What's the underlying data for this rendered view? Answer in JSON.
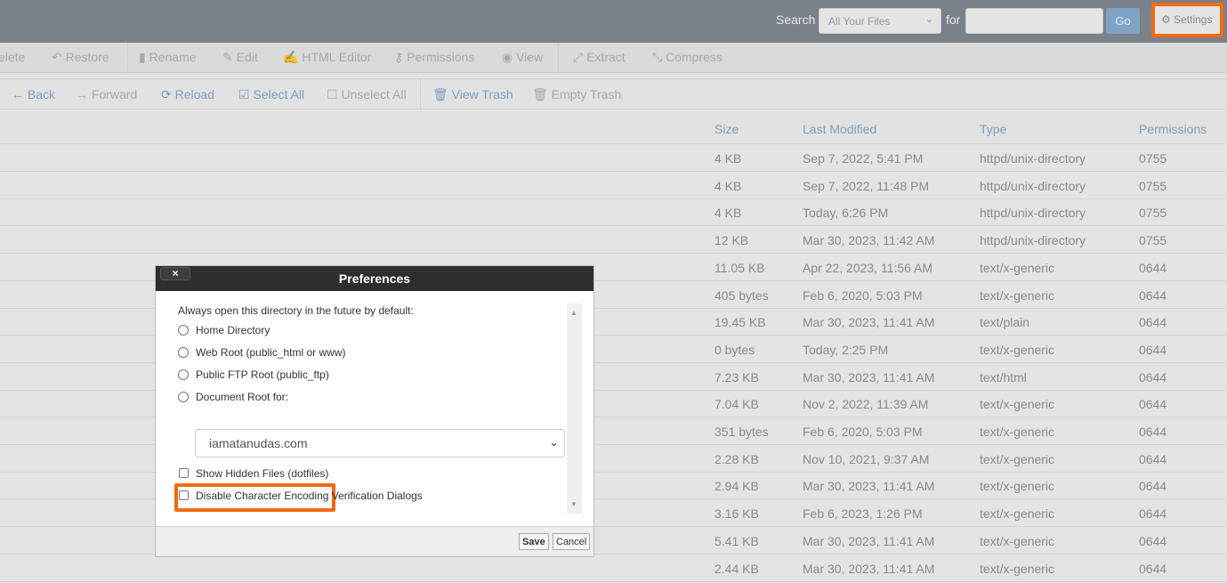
{
  "search": {
    "label": "Search",
    "scope": "All Your Files",
    "for_label": "for",
    "query": "",
    "go": "Go",
    "settings": "Settings"
  },
  "toolbar1": [
    "elete",
    "Restore",
    "Rename",
    "Edit",
    "HTML Editor",
    "Permissions",
    "View",
    "Extract",
    "Compress"
  ],
  "toolbar2": [
    "Back",
    "Forward",
    "Reload",
    "Select All",
    "Unselect All",
    "View Trash",
    "Empty Trash"
  ],
  "columns": [
    "Size",
    "Last Modified",
    "Type",
    "Permissions"
  ],
  "rows": [
    [
      "4 KB",
      "Sep 7, 2022, 5:41 PM",
      "httpd/unix-directory",
      "0755"
    ],
    [
      "4 KB",
      "Sep 7, 2022, 11:48 PM",
      "httpd/unix-directory",
      "0755"
    ],
    [
      "4 KB",
      "Today, 6:26 PM",
      "httpd/unix-directory",
      "0755"
    ],
    [
      "12 KB",
      "Mar 30, 2023, 11:42 AM",
      "httpd/unix-directory",
      "0755"
    ],
    [
      "11.05 KB",
      "Apr 22, 2023, 11:56 AM",
      "text/x-generic",
      "0644"
    ],
    [
      "405 bytes",
      "Feb 6, 2020, 5:03 PM",
      "text/x-generic",
      "0644"
    ],
    [
      "19.45 KB",
      "Mar 30, 2023, 11:41 AM",
      "text/plain",
      "0644"
    ],
    [
      "0 bytes",
      "Today, 2:25 PM",
      "text/x-generic",
      "0644"
    ],
    [
      "7.23 KB",
      "Mar 30, 2023, 11:41 AM",
      "text/html",
      "0644"
    ],
    [
      "7.04 KB",
      "Nov 2, 2022, 11:39 AM",
      "text/x-generic",
      "0644"
    ],
    [
      "351 bytes",
      "Feb 6, 2020, 5:03 PM",
      "text/x-generic",
      "0644"
    ],
    [
      "2.28 KB",
      "Nov 10, 2021, 9:37 AM",
      "text/x-generic",
      "0644"
    ],
    [
      "2.94 KB",
      "Mar 30, 2023, 11:41 AM",
      "text/x-generic",
      "0644"
    ],
    [
      "3.16 KB",
      "Feb 6, 2023, 1:26 PM",
      "text/x-generic",
      "0644"
    ],
    [
      "5.41 KB",
      "Mar 30, 2023, 11:41 AM",
      "text/x-generic",
      "0644"
    ],
    [
      "2.44 KB",
      "Mar 30, 2023, 11:41 AM",
      "text/x-generic",
      "0644"
    ]
  ],
  "dialog": {
    "title": "Preferences",
    "close": "×",
    "intro": "Always open this directory in the future by default:",
    "options": [
      "Home Directory",
      "Web Root (public_html or www)",
      "Public FTP Root (public_ftp)",
      "Document Root for:"
    ],
    "domain": "iamatanudas.com",
    "show_hidden": "Show Hidden Files (dotfiles)",
    "disable_encoding": "Disable Character Encoding Verification Dialogs",
    "save": "Save",
    "cancel": "Cancel"
  },
  "colors": {
    "highlight": "#f26a12",
    "link": "#7c9ec2",
    "topbar": "#7a8189"
  }
}
